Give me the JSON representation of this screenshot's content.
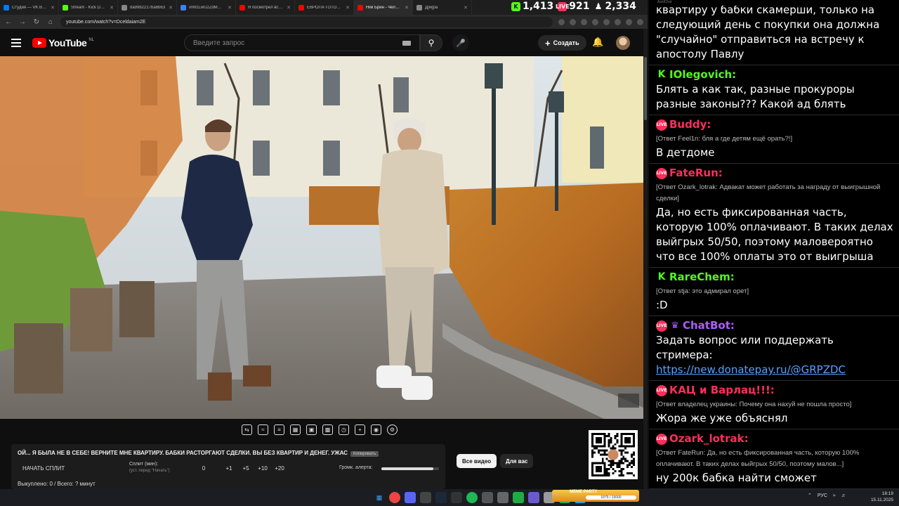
{
  "browser": {
    "tabs": [
      {
        "title": "Студия — VK Видео",
        "color": "#0077ff"
      },
      {
        "title": "Stream - Kick Dashb",
        "color": "#53fc18"
      },
      {
        "title": "da99b2217ba6b63",
        "color": "#888888"
      },
      {
        "title": "vIWzLwU2ZdMWyp",
        "color": "#3b82f6"
      },
      {
        "title": "Я посмотрел все Х",
        "color": "#ff0000"
      },
      {
        "title": "ЕВРОПА ГОТОВИТ",
        "color": "#ff0000"
      },
      {
        "title": "Ник Брин - Челове",
        "color": "#ff0000"
      },
      {
        "title": "Д[м]ра",
        "color": "#888888"
      }
    ],
    "url": "youtube.com/watch?v=Dceldaiam2E"
  },
  "stats": {
    "kick": "1,413",
    "vk": "921",
    "viewers": "2,334"
  },
  "youtube": {
    "logo_text": "YouTube",
    "region": "NL",
    "search_placeholder": "Введите запрос",
    "create_label": "Создать",
    "chips": [
      "Все видео",
      "Для вас"
    ]
  },
  "panel": {
    "title": "ОЙ... Я БЫЛА НЕ В СЕБЕ! ВЕРНИТЕ МНЕ КВАРТИРУ. БАБКИ РАСТОРГАЮТ СДЕЛКИ. ВЫ БЕЗ КВАРТИР И ДЕНЕГ. УЖАС",
    "copy_label": "Копировать",
    "start_label": "НАЧАТЬ СПЛИТ",
    "split_label": "Сплит (мин):",
    "split_sub": "(уст. перед \"Начать\")",
    "split_value": "0",
    "increments": [
      "+1",
      "+5",
      "+10",
      "+20"
    ],
    "volume_label": "Громк. алерта:",
    "volume_level": 0.9,
    "spent": "Выкуплено: 0 / Всего: ? минут"
  },
  "chat": {
    "window_title": "AxelChat",
    "messages": [
      {
        "platform": "none",
        "user": "",
        "reply": "",
        "text": "квартиру у бабки скамерши, только на следующий день с покупки она должна \"случайно\" отправиться на встречу к апостолу Павлу",
        "link": ""
      },
      {
        "platform": "kick",
        "user": "IOlegovich:",
        "reply": "",
        "text": "Блять а как так, разные прокуроры разные законы??? Какой ад блять",
        "link": ""
      },
      {
        "platform": "live",
        "user": "Buddy:",
        "reply": "[Ответ Feel1n: бля а где детям ещё орать?!]",
        "text": "В детдоме",
        "link": ""
      },
      {
        "platform": "live",
        "user": "FateRun:",
        "reply": "[Ответ Ozark_lotrak: Адвакат может работать за награду от выигрышной сделки]",
        "text": "Да, но есть фиксированная часть, которую 100% оплачивают. В таких делах выйгрых 50/50, поэтому маловероятно что все 100% оплаты это от выигрыша",
        "link": ""
      },
      {
        "platform": "kick",
        "user": "RareChem:",
        "reply": "[Ответ stja: это адмирал орет]",
        "text": ":D",
        "link": ""
      },
      {
        "platform": "bot",
        "user": "ChatBot:",
        "reply": "",
        "text": "Задать вопрос или поддержать стримера:",
        "link": "https://new.donatepay.ru/@GRPZDC"
      },
      {
        "platform": "live",
        "user": "КАЦ и Варлац!!!:",
        "reply": "[Ответ владелец украины: Почему она нахуй не пошла просто]",
        "text": "Жора же уже объяснял",
        "link": ""
      },
      {
        "platform": "live",
        "user": "Ozark_lotrak:",
        "reply": "[Ответ FateRun: Да, но есть фиксированная часть, которую 100% оплачивают. В таких делах выйгрых 50/50, поэтому малов...]",
        "text": "ну 200к бабка найти сможет",
        "link": ""
      }
    ]
  },
  "taskbar": {
    "meme_label": "MEME PARTY",
    "meme_progress": "1875 / 15000",
    "lang": "РУС",
    "time": "18:19",
    "date": "15.11.2025"
  },
  "colors": {
    "youtube_red": "#ff0000",
    "kick_green": "#53fc18",
    "live_pink": "#ff2e5b",
    "bot_purple": "#b05cff",
    "link_blue": "#5aa0ff"
  }
}
